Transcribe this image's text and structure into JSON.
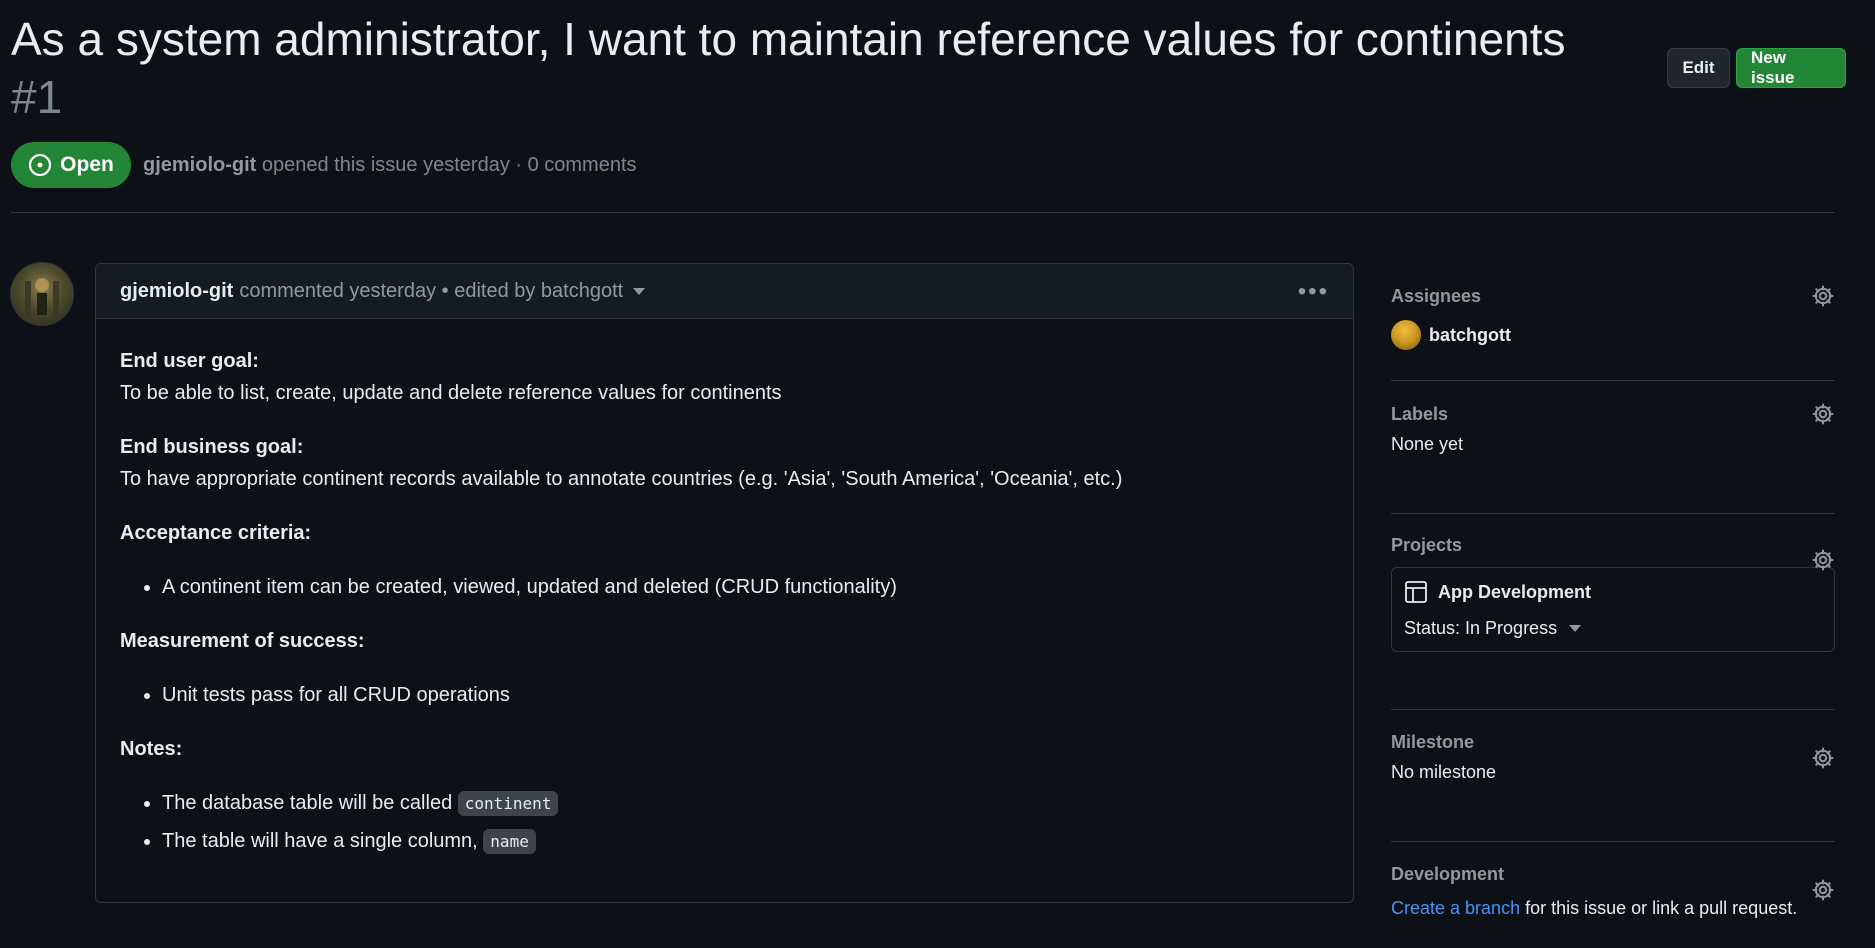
{
  "issue": {
    "title": "As a system administrator, I want to maintain reference values for continents",
    "number": "#1",
    "state": "Open",
    "author": "gjemiolo-git",
    "meta": "opened this issue yesterday · 0 comments"
  },
  "actions": {
    "edit_label": "Edit",
    "new_issue_label": "New issue"
  },
  "comment": {
    "author": "gjemiolo-git",
    "meta": "commented yesterday • edited by batchgott",
    "sections": {
      "goal_heading": "End user goal:",
      "goal_text": "To be able to list, create, update and delete reference values for continents",
      "business_heading": "End business goal:",
      "business_text": "To have appropriate continent records available to annotate countries (e.g. 'Asia', 'South America', 'Oceania', etc.)",
      "acceptance_heading": "Acceptance criteria:",
      "acceptance_items": [
        "A continent item can be created, viewed, updated and deleted (CRUD functionality)"
      ],
      "success_heading": "Measurement of success:",
      "success_items": [
        "Unit tests pass for all CRUD operations"
      ],
      "notes_heading": "Notes:",
      "note1_text": "The database table will be called",
      "note1_code": "continent",
      "note2_text": "The table will have a single column,",
      "note2_code": "name"
    }
  },
  "sidebar": {
    "assignees": {
      "title": "Assignees",
      "name": "batchgott"
    },
    "labels": {
      "title": "Labels",
      "value": "None yet"
    },
    "projects": {
      "title": "Projects",
      "project_name": "App Development",
      "status": "Status: In Progress"
    },
    "milestone": {
      "title": "Milestone",
      "value": "No milestone"
    },
    "development": {
      "title": "Development",
      "link_text": "Create a branch",
      "rest_text": "for this issue or link a pull request."
    }
  }
}
